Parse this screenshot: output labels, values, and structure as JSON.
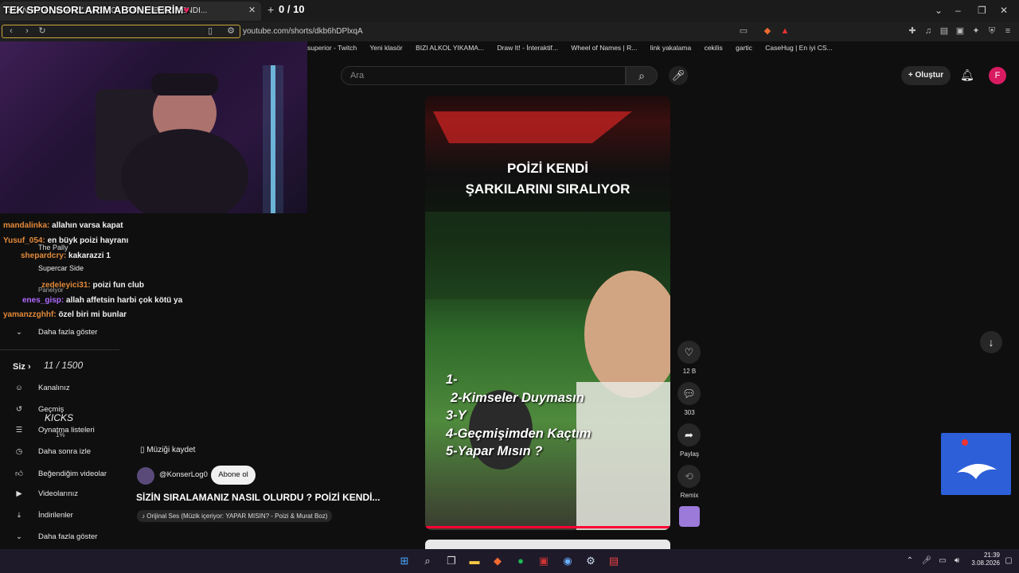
{
  "browser": {
    "tab_title": "SİZİN SIRALAMANIZ NASIL OLURDU ? POİZİ KENDİ...",
    "overlay_title": "TEK SPONSORLARIM ABONELERİM",
    "counter": "0 / 10",
    "url": "youtube.com/shorts/dkb6hDPlxqA",
    "bookmarks": [
      "superior - Twitch",
      "Yeni klasör",
      "BIZI ALKOL YIKAMA...",
      "Draw It! - İnteraktif...",
      "Wheel of Names | R...",
      "link yakalama",
      "cekilis",
      "gartic",
      "CaseHug | En iyi CS..."
    ]
  },
  "header": {
    "search_placeholder": "Ara",
    "create_label": "Oluştur",
    "avatar_letter": "F"
  },
  "chat": [
    {
      "user": "mandalinka:",
      "text": "allahın varsa kapat"
    },
    {
      "user": "Yusuf_054:",
      "text": "en büyk poizi hayranı"
    },
    {
      "user": "shepardcry:",
      "text": "kakarazzi 1"
    },
    {
      "user": "Supercar Side",
      "text": ""
    },
    {
      "user": "zedeleyici31:",
      "text": "poizi fun club"
    },
    {
      "user": "enes_gisp:",
      "text": "allah affetsin harbi çok kötü ya"
    },
    {
      "user": "yamanzzghhf:",
      "text": "özel biri mi bunlar"
    }
  ],
  "chat_misc": {
    "channel_name": "The Pally",
    "panelist": "Panelyor",
    "subs_counter": "11 / 1500",
    "kicks": "KICKS",
    "kicks_pct": "1%"
  },
  "sidebar": {
    "more_1": "Daha fazla göster",
    "you_label": "Siz",
    "items": [
      "Kanalınız",
      "Geçmiş",
      "Oynatma listeleri",
      "Daha sonra izle",
      "Beğendiğim videolar",
      "Videolarınız",
      "İndirilenler",
      "Daha fazla göster"
    ]
  },
  "short": {
    "title_line1": "POİZİ KENDİ",
    "title_line2": "ŞARKILARINI SIRALIYOR",
    "list": [
      "1-",
      "2-Kimseler Duymasın",
      "3-Y",
      "4-Geçmişimden Kaçtım",
      "5-Yapar Mısın ?"
    ],
    "like_count": "12 B",
    "comment_count": "303",
    "share_label": "Paylaş",
    "remix_label": "Remix",
    "save_music": "Müziği kaydet",
    "channel": "@KonserLog0",
    "subscribe": "Abone ol",
    "video_title": "SİZİN SIRALAMANIZ NASIL OLURDU ? POİZİ KENDİ...",
    "audio": "Orijinal Ses (Müzik içeriyor: YAPAR MISIN? - Poizi & Murat Boz)"
  },
  "taskbar": {
    "time": "21:39",
    "date": "3.08.2026"
  },
  "colors": {
    "accent_red": "#ff0033",
    "avatar": "#d81b60",
    "chat_user": "#e48a3a"
  }
}
